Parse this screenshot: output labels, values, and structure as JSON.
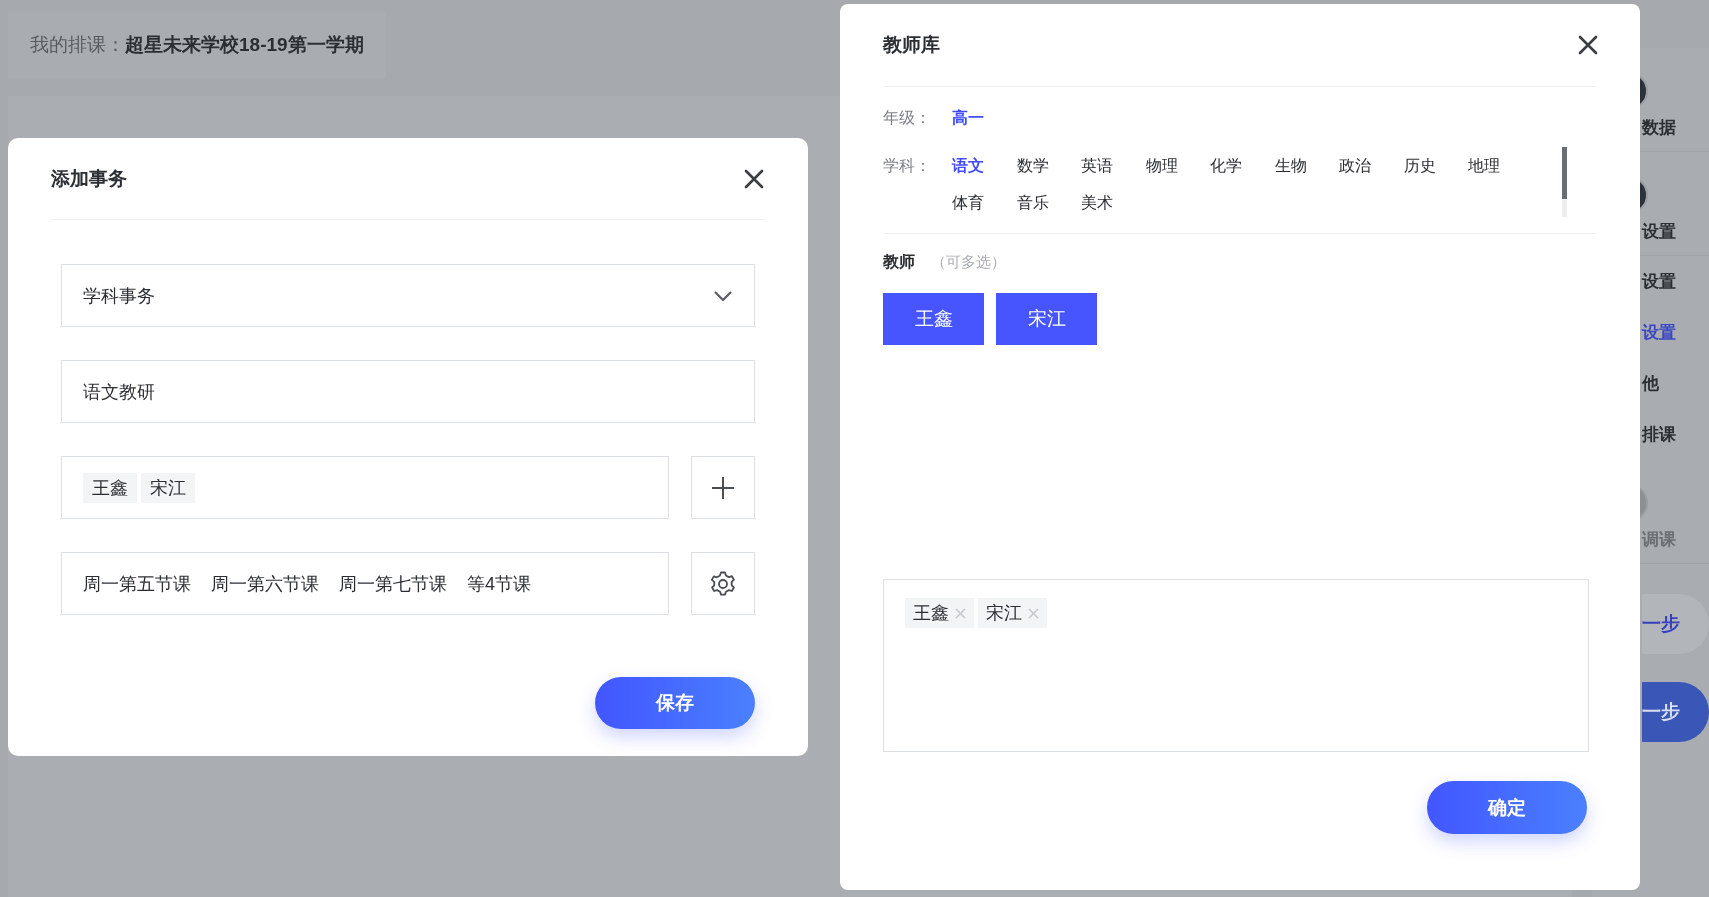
{
  "page": {
    "breadcrumb_label": "我的排课：",
    "school_term": "超星未来学校18-19第一学期"
  },
  "steps_sidebar": {
    "items": [
      {
        "kind": "step",
        "label": "数据",
        "active": true
      },
      {
        "kind": "step",
        "label": "设置",
        "active": true
      },
      {
        "kind": "sub",
        "label": "设置",
        "selected": false
      },
      {
        "kind": "sub",
        "label": "设置",
        "selected": true
      },
      {
        "kind": "sub",
        "label": "他",
        "selected": false
      },
      {
        "kind": "sub",
        "label": "排课",
        "selected": false
      },
      {
        "kind": "step",
        "label": "调课",
        "active": false
      }
    ]
  },
  "nav_buttons": [
    {
      "kind": "secondary",
      "label": "一步"
    },
    {
      "kind": "primary",
      "label": "一步"
    }
  ],
  "add_dialog": {
    "title": "添加事务",
    "type_select": {
      "value": "学科事务"
    },
    "name_field": {
      "value": "语文教研"
    },
    "teachers_field": {
      "tags": [
        "王鑫",
        "宋江"
      ]
    },
    "periods_field": {
      "items": [
        "周一第五节课",
        "周一第六节课",
        "周一第七节课",
        "等4节课"
      ]
    },
    "save_button": "保存"
  },
  "teacher_dialog": {
    "title": "教师库",
    "grade": {
      "label": "年级：",
      "options": [
        {
          "label": "高一",
          "selected": true
        }
      ]
    },
    "subject": {
      "label": "学科：",
      "options": [
        {
          "label": "语文",
          "selected": true
        },
        {
          "label": "数学",
          "selected": false
        },
        {
          "label": "英语",
          "selected": false
        },
        {
          "label": "物理",
          "selected": false
        },
        {
          "label": "化学",
          "selected": false
        },
        {
          "label": "生物",
          "selected": false
        },
        {
          "label": "政治",
          "selected": false
        },
        {
          "label": "历史",
          "selected": false
        },
        {
          "label": "地理",
          "selected": false
        },
        {
          "label": "体育",
          "selected": false
        },
        {
          "label": "音乐",
          "selected": false
        },
        {
          "label": "美术",
          "selected": false
        }
      ]
    },
    "teachers": {
      "label": "教师",
      "hint": "（可多选）",
      "items": [
        {
          "name": "王鑫",
          "selected": true
        },
        {
          "name": "宋江",
          "selected": true
        }
      ]
    },
    "chosen": [
      "王鑫",
      "宋江"
    ],
    "confirm_button": "确定"
  }
}
